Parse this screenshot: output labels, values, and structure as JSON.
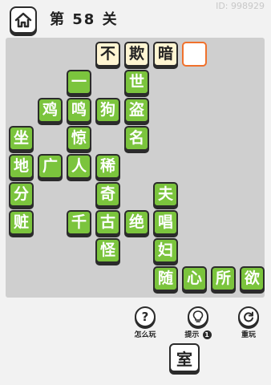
{
  "header": {
    "title": "第 58 关",
    "user_id": "ID: 998929"
  },
  "board": {
    "answer_row": [
      "不",
      "欺",
      "暗",
      ""
    ],
    "grid": [
      [
        "一",
        "世"
      ],
      [
        "鸡",
        "鸣",
        "狗",
        "盗"
      ],
      [
        "坐",
        "惊",
        "名"
      ],
      [
        "地",
        "广",
        "人",
        "稀"
      ],
      [
        "分",
        "奇",
        "夫"
      ],
      [
        "赃",
        "千",
        "古",
        "绝",
        "唱"
      ],
      [
        "怪",
        "妇"
      ],
      [
        "随",
        "心",
        "所",
        "欲"
      ]
    ]
  },
  "actions": {
    "how_to_play": "怎么玩",
    "hint": "提示",
    "hint_count": "1",
    "restart": "重玩"
  },
  "candidates": [
    "室"
  ],
  "colors": {
    "tile_green": "#7bc43d",
    "tile_cream": "#fff5d2",
    "selected_border": "#f0712c",
    "board_bg": "#cfcfcf"
  }
}
